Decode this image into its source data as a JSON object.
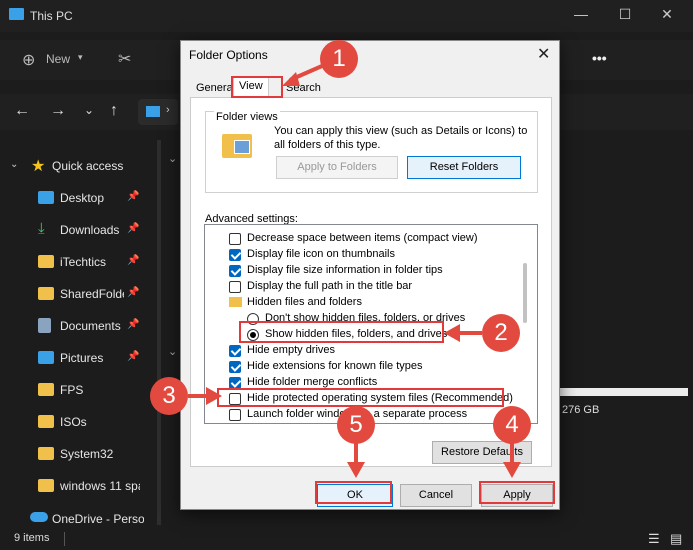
{
  "window": {
    "title": "This PC",
    "min": "—",
    "max": "☐",
    "close": "✕"
  },
  "toolbar": {
    "new_label": "New",
    "more": "•••"
  },
  "sidebar": {
    "quick_access": "Quick access",
    "items": [
      {
        "label": "Desktop",
        "pinned": true
      },
      {
        "label": "Downloads",
        "pinned": true
      },
      {
        "label": "iTechtics",
        "pinned": true
      },
      {
        "label": "SharedFolde",
        "pinned": true
      },
      {
        "label": "Documents",
        "pinned": true
      },
      {
        "label": "Pictures",
        "pinned": true
      },
      {
        "label": "FPS",
        "pinned": false
      },
      {
        "label": "ISOs",
        "pinned": false
      },
      {
        "label": "System32",
        "pinned": false
      },
      {
        "label": "windows 11 spa",
        "pinned": false
      },
      {
        "label": "OneDrive - Perso",
        "pinned": false
      }
    ]
  },
  "drive": {
    "size_text": "276 GB"
  },
  "status": {
    "items": "9 items"
  },
  "dialog": {
    "title": "Folder Options",
    "tabs": [
      "General",
      "View",
      "Search"
    ],
    "folder_views_title": "Folder views",
    "folder_views_text": "You can apply this view (such as Details or Icons) to all folders of this type.",
    "apply_to_folders": "Apply to Folders",
    "reset_folders": "Reset Folders",
    "advanced_label": "Advanced settings:",
    "settings": [
      {
        "type": "checkbox",
        "checked": false,
        "label": "Decrease space between items (compact view)"
      },
      {
        "type": "checkbox",
        "checked": true,
        "label": "Display file icon on thumbnails"
      },
      {
        "type": "checkbox",
        "checked": true,
        "label": "Display file size information in folder tips"
      },
      {
        "type": "checkbox",
        "checked": false,
        "label": "Display the full path in the title bar"
      },
      {
        "type": "folder",
        "label": "Hidden files and folders"
      },
      {
        "type": "radio",
        "checked": false,
        "label": "Don't show hidden files, folders, or drives"
      },
      {
        "type": "radio",
        "checked": true,
        "label": "Show hidden files, folders, and drives"
      },
      {
        "type": "checkbox",
        "checked": true,
        "label": "Hide empty drives"
      },
      {
        "type": "checkbox",
        "checked": true,
        "label": "Hide extensions for known file types"
      },
      {
        "type": "checkbox",
        "checked": true,
        "label": "Hide folder merge conflicts"
      },
      {
        "type": "checkbox",
        "checked": false,
        "label": "Hide protected operating system files (Recommended)"
      },
      {
        "type": "checkbox",
        "checked": false,
        "label": "Launch folder windows in a separate process"
      }
    ],
    "restore_defaults": "Restore Defaults",
    "ok": "OK",
    "cancel": "Cancel",
    "apply": "Apply"
  },
  "annotations": {
    "n1": "1",
    "n2": "2",
    "n3": "3",
    "n4": "4",
    "n5": "5"
  },
  "colors": {
    "accent": "#0067c0",
    "annotation": "#e24a3f"
  }
}
